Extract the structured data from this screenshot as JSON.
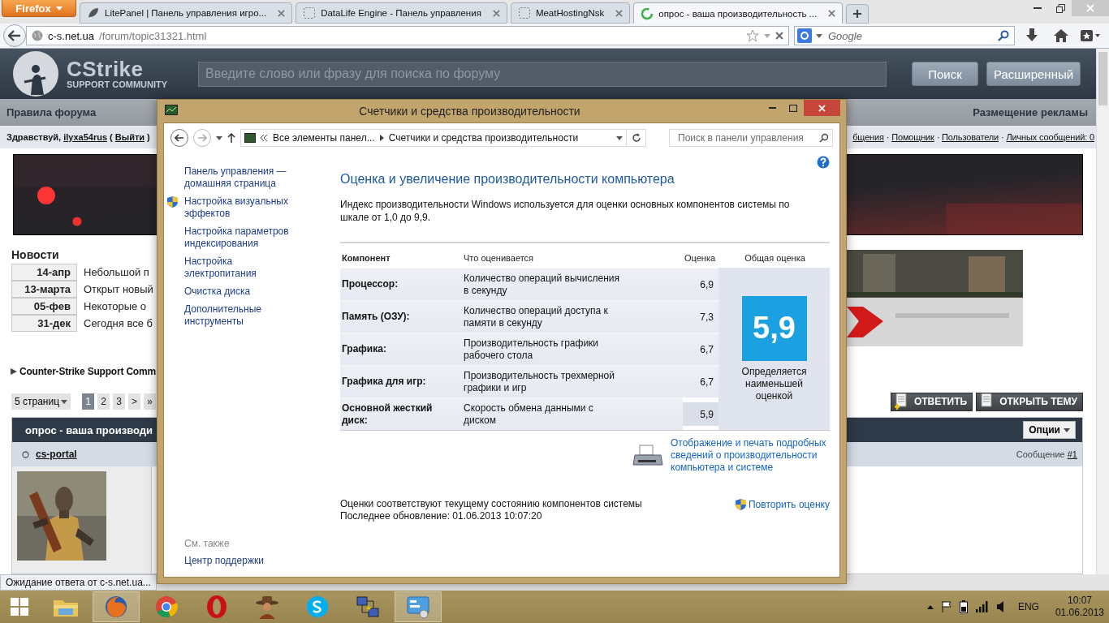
{
  "browser": {
    "menu_button": "Firefox",
    "tabs": [
      {
        "title": "LitePanel | Панель управления игро...",
        "selected": false,
        "kind": "leaf"
      },
      {
        "title": "DataLife Engine - Панель управления",
        "selected": false,
        "kind": "blank"
      },
      {
        "title": "MeatHostingNsk",
        "selected": false,
        "kind": "blank"
      },
      {
        "title": "опрос - ваша производительность ...",
        "selected": true,
        "kind": "loading"
      }
    ],
    "url": {
      "host": "c-s.net.ua",
      "path": "/forum/topic31321.html"
    },
    "search": {
      "placeholder": "Google"
    },
    "status": "Ожидание ответа от c-s.net.ua..."
  },
  "forum": {
    "logo": {
      "title": "CStrike",
      "subtitle": "SUPPORT COMMUNITY"
    },
    "search": {
      "placeholder": "Введите слово или фразу для поиска по форуму"
    },
    "search_buttons": [
      "Поиск",
      "Расширенный"
    ],
    "nav_left": "Правила форума",
    "nav_right": "Размещение рекламы",
    "greeting": [
      {
        "kind": "text",
        "text": "Здравствуй, "
      },
      {
        "kind": "link",
        "text": "ilyxa54rus"
      },
      {
        "kind": "text",
        "text": " ( "
      },
      {
        "kind": "link",
        "text": "Выйти"
      },
      {
        "kind": "text",
        "text": " )"
      }
    ],
    "user_links": [
      {
        "kind": "link",
        "text": "бщения"
      },
      {
        "kind": "text",
        "text": " · "
      },
      {
        "kind": "link",
        "text": "Помощник"
      },
      {
        "kind": "text",
        "text": " · "
      },
      {
        "kind": "link",
        "text": "Пользователи"
      },
      {
        "kind": "text",
        "text": " · "
      },
      {
        "kind": "link",
        "text": "Личных сообщений: 0"
      }
    ],
    "news_heading": "Новости",
    "news": [
      {
        "date": "14-апр",
        "title": "Небольшой п"
      },
      {
        "date": "13-марта",
        "title": "Открыт новый"
      },
      {
        "date": "05-фев",
        "title": "Некоторые о"
      },
      {
        "date": "31-дек",
        "title": "Сегодня все б"
      }
    ],
    "forum_path": "Counter-Strike Support Comm",
    "pagination": {
      "pages_label": "5 страниц",
      "pages": [
        {
          "label": "1",
          "selected": true
        },
        {
          "label": "2",
          "selected": false
        },
        {
          "label": "3",
          "selected": false
        },
        {
          "label": ">",
          "selected": false
        },
        {
          "label": "»",
          "selected": false
        }
      ]
    },
    "topic_buttons": [
      {
        "label": "ОТВЕТИТЬ",
        "kind": "reply"
      },
      {
        "label": "ОТКРЫТЬ ТЕМУ",
        "kind": "new"
      }
    ],
    "post": {
      "title": "опрос - ваша производи",
      "options": "Опции",
      "author": "cs-portal",
      "online": false,
      "post_label": "Сообщение",
      "post_number": "#1"
    }
  },
  "dialog": {
    "title": "Счетчики и средства производительности",
    "breadcrumb": [
      "Все элементы панел...",
      "Счетчики и средства производительности"
    ],
    "search_placeholder": "Поиск в панели управления",
    "sidebar": [
      {
        "label": "Панель управления — домашняя страница",
        "shield": false
      },
      {
        "label": "Настройка визуальных эффектов",
        "shield": true
      },
      {
        "label": "Настройка параметров индексирования",
        "shield": false
      },
      {
        "label": "Настройка электропитания",
        "shield": false
      },
      {
        "label": "Очистка диска",
        "shield": false
      },
      {
        "label": "Дополнительные инструменты",
        "shield": false
      }
    ],
    "see_also": {
      "heading": "См. также",
      "links": [
        "Центр поддержки"
      ]
    },
    "heading": "Оценка и увеличение производительности компьютера",
    "description": "Индекс производительности Windows используется для оценки основных компонентов системы по шкале от 1,0 до 9,9.",
    "table": {
      "columns": [
        "Компонент",
        "Что оценивается",
        "Оценка",
        "Общая оценка"
      ],
      "rows": [
        {
          "component": "Процессор:",
          "measures": "Количество операций вычисления в секунду",
          "score": "6,9",
          "lowest": false
        },
        {
          "component": "Память (ОЗУ):",
          "measures": "Количество операций доступа к памяти в секунду",
          "score": "7,3",
          "lowest": false
        },
        {
          "component": "Графика:",
          "measures": "Производительность графики рабочего стола",
          "score": "6,7",
          "lowest": false
        },
        {
          "component": "Графика для игр:",
          "measures": "Производительность трехмерной графики и игр",
          "score": "6,7",
          "lowest": false
        },
        {
          "component": "Основной жесткий диск:",
          "measures": "Скорость обмена данными с диском",
          "score": "5,9",
          "lowest": true
        }
      ],
      "base_score": "5,9",
      "base_note": "Определяется наименьшей оценкой"
    },
    "print_link": "Отображение и печать подробных сведений о производительности компьютера и системе",
    "status_lines": [
      "Оценки соответствуют текущему состоянию компонентов системы",
      "Последнее обновление: 01.06.2013 10:07:20"
    ],
    "rerun": "Повторить оценку"
  },
  "taskbar": {
    "items": [
      {
        "kind": "folder",
        "active": false
      },
      {
        "kind": "firefox",
        "active": true
      },
      {
        "kind": "chrome",
        "active": false
      },
      {
        "kind": "opera",
        "active": false
      },
      {
        "kind": "cowboy",
        "active": false
      },
      {
        "kind": "skype",
        "active": false
      },
      {
        "kind": "network",
        "active": false
      },
      {
        "kind": "control-panel",
        "active": true
      }
    ],
    "language": "ENG",
    "time": "10:07",
    "date": "01.06.2013"
  }
}
